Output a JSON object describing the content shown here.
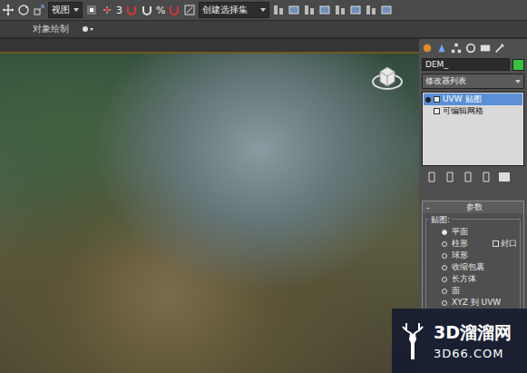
{
  "toolbar": {
    "view_dropdown": "视图",
    "snap_number": "3",
    "percent": "%",
    "selection_set": "创建选择集"
  },
  "subbar": {
    "label": "对象绘制"
  },
  "panel": {
    "object_name": "DEM_",
    "object_color": "#35c43a",
    "modifier_list": "修改器列表",
    "stack": [
      {
        "label": "UVW 贴图",
        "selected": true
      },
      {
        "label": "可编辑网格",
        "selected": false
      }
    ],
    "rollout": {
      "toggle": "-",
      "title": "参数",
      "group": "贴图:",
      "options": [
        {
          "label": "平面",
          "selected": true
        },
        {
          "label": "柱形",
          "selected": false
        },
        {
          "label": "球形",
          "selected": false
        },
        {
          "label": "收缩包裹",
          "selected": false
        },
        {
          "label": "长方体",
          "selected": false
        },
        {
          "label": "面",
          "selected": false
        },
        {
          "label": "XYZ 到 UVW",
          "selected": false
        }
      ],
      "cap": {
        "label": "封口",
        "checked": false
      }
    }
  },
  "watermark": {
    "brand": "3D溜溜网",
    "url": "3D66.COM"
  }
}
